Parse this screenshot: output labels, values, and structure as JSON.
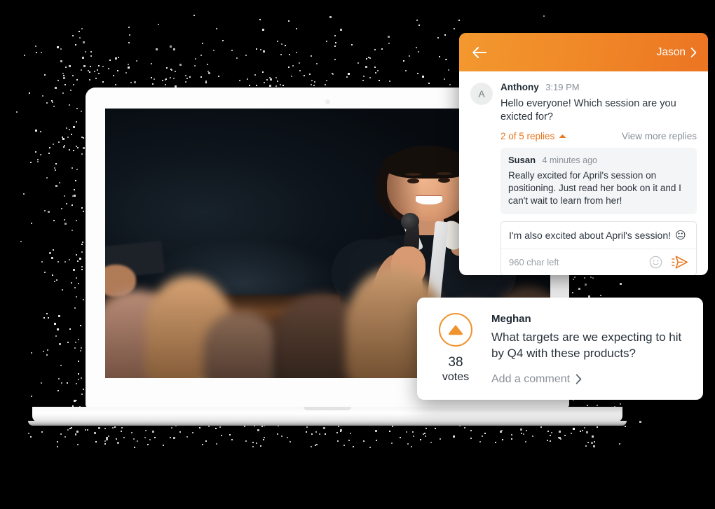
{
  "background": {
    "color": "#000000"
  },
  "device": {
    "name": "laptop",
    "bezel_color": "#fdfdfd"
  },
  "photo": {
    "alt": "Woman speaking into a microphone at a conference with blurred audience in foreground"
  },
  "chat": {
    "header": {
      "back_icon": "arrow-left-icon",
      "user": "Jason",
      "chevron_icon": "chevron-right-icon",
      "gradient_from": "#f3982f",
      "gradient_to": "#ec7422"
    },
    "message": {
      "avatar_initial": "A",
      "author": "Anthony",
      "time": "3:19 PM",
      "text": "Hello everyone! Which session are you exicted for?",
      "replies_count_label": "2 of 5 replies",
      "replies_caret_icon": "caret-up-icon",
      "view_more_label": "View more replies"
    },
    "reply": {
      "author": "Susan",
      "time": "4 minutes ago",
      "text": "Really excited for April's session on positioning. Just read her book on it and I can't wait to learn from her!"
    },
    "composer": {
      "value": "I'm also excited about April's session!",
      "emoji": "😐",
      "char_left": "960 char left",
      "emoji_icon": "smiley-icon",
      "send_icon": "send-icon",
      "accent": "#e8761e"
    }
  },
  "question_card": {
    "vote": {
      "upvote_icon": "upvote-triangle-icon",
      "count": "38",
      "label": "votes",
      "accent": "#f0932f"
    },
    "author": "Meghan",
    "text": "What targets are we expecting to hit by Q4 with these products?",
    "add_comment_label": "Add a comment",
    "add_comment_icon": "chevron-right-icon"
  }
}
